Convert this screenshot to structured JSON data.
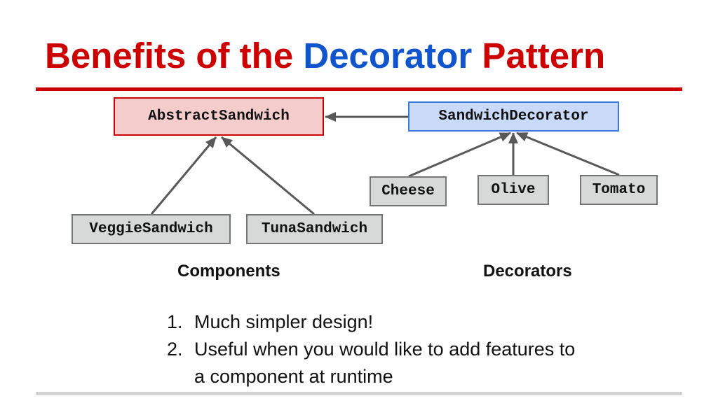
{
  "slide": {
    "title": {
      "part1": "Benefits of the ",
      "highlight": "Decorator",
      "part2": " Pattern"
    },
    "colors": {
      "title_red": "#cc0000",
      "title_blue": "#1155cc",
      "abstract_fill": "#f4cccc",
      "decorator_fill": "#c9daf8",
      "concrete_fill": "#d7d8d8",
      "arrow": "#595959"
    }
  },
  "diagram": {
    "nodes": [
      {
        "id": "abstract-sandwich",
        "label": "AbstractSandwich",
        "kind": "abstract-component"
      },
      {
        "id": "sandwich-decorator",
        "label": "SandwichDecorator",
        "kind": "abstract-decorator"
      },
      {
        "id": "cheese",
        "label": "Cheese",
        "kind": "decorator"
      },
      {
        "id": "olive",
        "label": "Olive",
        "kind": "decorator"
      },
      {
        "id": "tomato",
        "label": "Tomato",
        "kind": "decorator"
      },
      {
        "id": "veggie-sandwich",
        "label": "VeggieSandwich",
        "kind": "component"
      },
      {
        "id": "tuna-sandwich",
        "label": "TunaSandwich",
        "kind": "component"
      }
    ],
    "edges": [
      {
        "from": "SandwichDecorator",
        "to": "AbstractSandwich"
      },
      {
        "from": "VeggieSandwich",
        "to": "AbstractSandwich"
      },
      {
        "from": "TunaSandwich",
        "to": "AbstractSandwich"
      },
      {
        "from": "Cheese",
        "to": "SandwichDecorator"
      },
      {
        "from": "Olive",
        "to": "SandwichDecorator"
      },
      {
        "from": "Tomato",
        "to": "SandwichDecorator"
      }
    ],
    "group_labels": {
      "components": "Components",
      "decorators": "Decorators"
    }
  },
  "bullets": [
    {
      "number": "1.",
      "text": "Much simpler design!"
    },
    {
      "number": "2.",
      "text": "Useful when you would like to add features to a component at runtime"
    }
  ]
}
